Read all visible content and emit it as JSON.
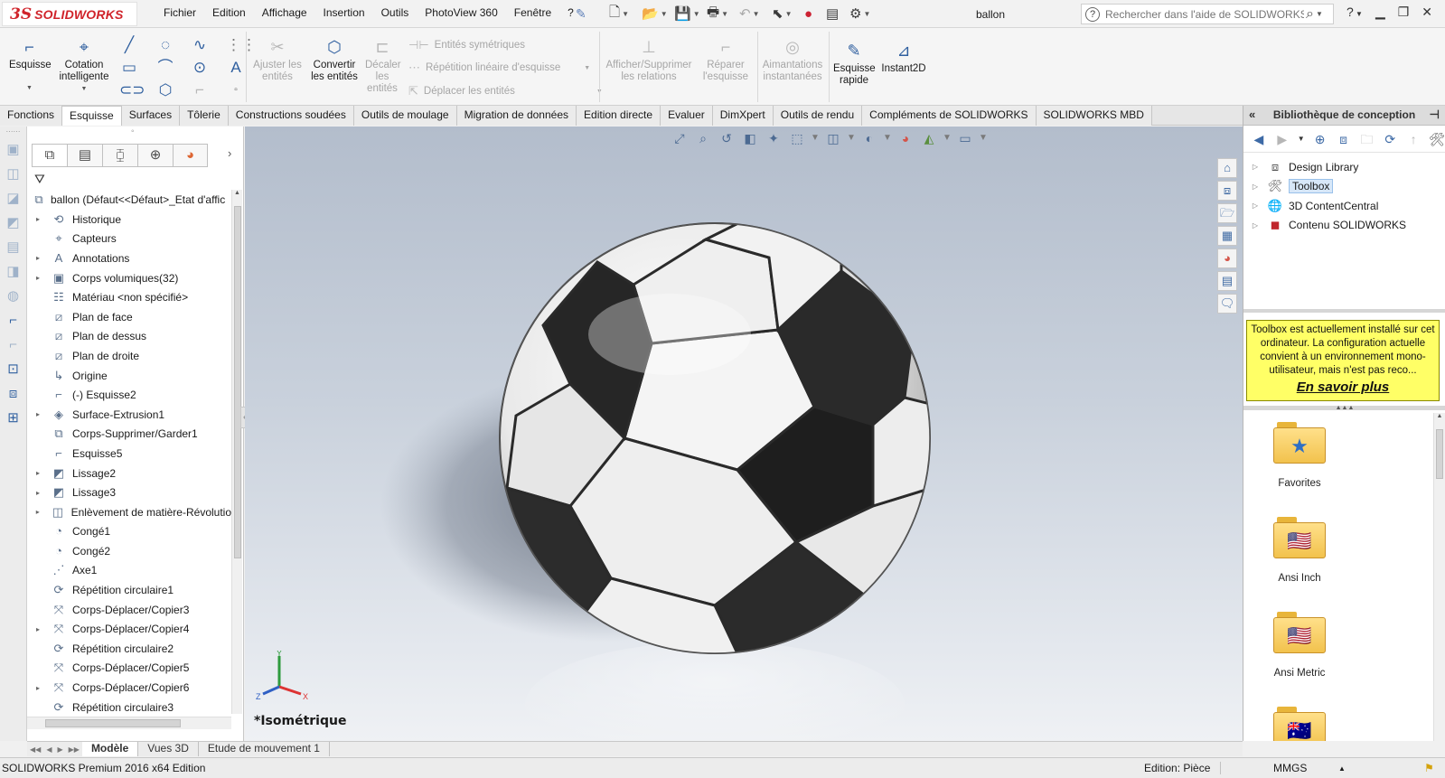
{
  "app": {
    "brand_mark": "3S",
    "brand": "SOLIDWORKS",
    "doc_title": "ballon"
  },
  "menu": [
    "Fichier",
    "Edition",
    "Affichage",
    "Insertion",
    "Outils",
    "PhotoView 360",
    "Fenêtre",
    "?"
  ],
  "help_search": {
    "placeholder": "Rechercher dans l'aide de SOLIDWORKS"
  },
  "ribbon": {
    "esquisse": "Esquisse",
    "cotation": "Cotation intelligente",
    "ajuster": "Ajuster les entités",
    "convertir": "Convertir les entités",
    "decaler": "Décaler les entités",
    "symetriques": "Entités symétriques",
    "repetition_lineaire": "Répétition linéaire d'esquisse",
    "deplacer": "Déplacer les entités",
    "relations": "Afficher/Supprimer les relations",
    "reparer": "Réparer l'esquisse",
    "aimantations": "Aimantations instantanées",
    "esquisse_rapide": "Esquisse rapide",
    "instant2d": "Instant2D"
  },
  "cm_tabs": [
    "Fonctions",
    "Esquisse",
    "Surfaces",
    "Tôlerie",
    "Constructions soudées",
    "Outils de moulage",
    "Migration de données",
    "Edition directe",
    "Evaluer",
    "DimXpert",
    "Outils de rendu",
    "Compléments de SOLIDWORKS",
    "SOLIDWORKS MBD"
  ],
  "cm_active": "Esquisse",
  "feature_tree": {
    "root": "ballon  (Défaut<<Défaut>_Etat d'affic",
    "items": [
      {
        "label": "Historique",
        "icon": "history-icon",
        "expand": true
      },
      {
        "label": "Capteurs",
        "icon": "sensor-icon",
        "expand": false
      },
      {
        "label": "Annotations",
        "icon": "annotation-icon",
        "expand": true
      },
      {
        "label": "Corps volumiques(32)",
        "icon": "solid-bodies-icon",
        "expand": true
      },
      {
        "label": "Matériau <non spécifié>",
        "icon": "material-icon",
        "expand": false
      },
      {
        "label": "Plan de face",
        "icon": "plane-icon",
        "expand": false
      },
      {
        "label": "Plan de dessus",
        "icon": "plane-icon",
        "expand": false
      },
      {
        "label": "Plan de droite",
        "icon": "plane-icon",
        "expand": false
      },
      {
        "label": "Origine",
        "icon": "origin-icon",
        "expand": false
      },
      {
        "label": "(-) Esquisse2",
        "icon": "sketch-icon",
        "expand": false
      },
      {
        "label": "Surface-Extrusion1",
        "icon": "surface-extrude-icon",
        "expand": true
      },
      {
        "label": "Corps-Supprimer/Garder1",
        "icon": "body-delete-icon",
        "expand": false
      },
      {
        "label": "Esquisse5",
        "icon": "sketch-icon",
        "expand": false
      },
      {
        "label": "Lissage2",
        "icon": "loft-icon",
        "expand": true
      },
      {
        "label": "Lissage3",
        "icon": "loft-icon",
        "expand": true
      },
      {
        "label": "Enlèvement de matière-Révolutio",
        "icon": "revolve-cut-icon",
        "expand": true
      },
      {
        "label": "Congé1",
        "icon": "fillet-icon",
        "expand": false
      },
      {
        "label": "Congé2",
        "icon": "fillet-icon",
        "expand": false
      },
      {
        "label": "Axe1",
        "icon": "axis-icon",
        "expand": false
      },
      {
        "label": "Répétition circulaire1",
        "icon": "circular-pattern-icon",
        "expand": false
      },
      {
        "label": "Corps-Déplacer/Copier3",
        "icon": "move-copy-icon",
        "expand": false
      },
      {
        "label": "Corps-Déplacer/Copier4",
        "icon": "move-copy-icon",
        "expand": true
      },
      {
        "label": "Répétition circulaire2",
        "icon": "circular-pattern-icon",
        "expand": false
      },
      {
        "label": "Corps-Déplacer/Copier5",
        "icon": "move-copy-icon",
        "expand": false
      },
      {
        "label": "Corps-Déplacer/Copier6",
        "icon": "move-copy-icon",
        "expand": true
      },
      {
        "label": "Répétition circulaire3",
        "icon": "circular-pattern-icon",
        "expand": false
      }
    ]
  },
  "viewport": {
    "view_label": "*Isométrique",
    "axis_x": "X",
    "axis_y": "Y",
    "axis_z": "Z"
  },
  "design_library": {
    "title": "Bibliothèque de conception",
    "tree": [
      {
        "label": "Design Library",
        "icon": "design-library-icon",
        "selected": false
      },
      {
        "label": "Toolbox",
        "icon": "toolbox-icon",
        "selected": true
      },
      {
        "label": "3D ContentCentral",
        "icon": "globe-icon",
        "selected": false
      },
      {
        "label": "Contenu SOLIDWORKS",
        "icon": "sw-content-icon",
        "selected": false
      }
    ],
    "note": "Toolbox est actuellement installé sur cet ordinateur. La configuration actuelle convient à un environnement mono-utilisateur, mais n'est pas reco...",
    "note_link": "En savoir plus",
    "folders": [
      {
        "label": "Favorites",
        "icon": "star-icon"
      },
      {
        "label": "Ansi Inch",
        "icon": "us-flag-icon"
      },
      {
        "label": "Ansi Metric",
        "icon": "us-flag-icon"
      },
      {
        "label": "",
        "icon": "au-flag-icon"
      }
    ]
  },
  "bottom_tabs": [
    "Modèle",
    "Vues 3D",
    "Etude de mouvement 1"
  ],
  "bottom_active": "Modèle",
  "status": {
    "version": "SOLIDWORKS Premium 2016 x64 Edition",
    "mode": "Edition: Pièce",
    "units": "MMGS"
  },
  "colors": {
    "brand_red": "#d0232a",
    "note_yellow": "#ffff66",
    "accent_blue": "#2f5f9f"
  }
}
